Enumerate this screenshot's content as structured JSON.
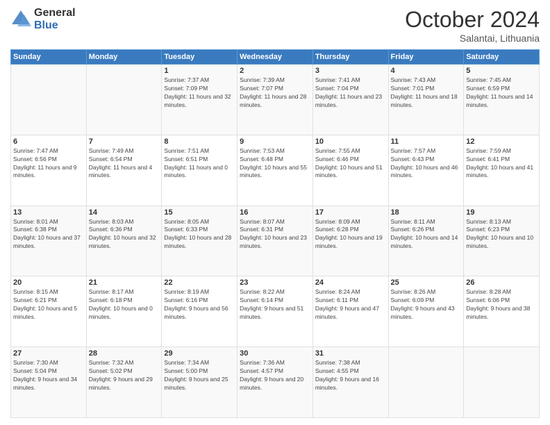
{
  "logo": {
    "general": "General",
    "blue": "Blue"
  },
  "header": {
    "month": "October 2024",
    "location": "Salantai, Lithuania"
  },
  "weekdays": [
    "Sunday",
    "Monday",
    "Tuesday",
    "Wednesday",
    "Thursday",
    "Friday",
    "Saturday"
  ],
  "weeks": [
    [
      {
        "day": "",
        "sunrise": "",
        "sunset": "",
        "daylight": ""
      },
      {
        "day": "",
        "sunrise": "",
        "sunset": "",
        "daylight": ""
      },
      {
        "day": "1",
        "sunrise": "Sunrise: 7:37 AM",
        "sunset": "Sunset: 7:09 PM",
        "daylight": "Daylight: 11 hours and 32 minutes."
      },
      {
        "day": "2",
        "sunrise": "Sunrise: 7:39 AM",
        "sunset": "Sunset: 7:07 PM",
        "daylight": "Daylight: 11 hours and 28 minutes."
      },
      {
        "day": "3",
        "sunrise": "Sunrise: 7:41 AM",
        "sunset": "Sunset: 7:04 PM",
        "daylight": "Daylight: 11 hours and 23 minutes."
      },
      {
        "day": "4",
        "sunrise": "Sunrise: 7:43 AM",
        "sunset": "Sunset: 7:01 PM",
        "daylight": "Daylight: 11 hours and 18 minutes."
      },
      {
        "day": "5",
        "sunrise": "Sunrise: 7:45 AM",
        "sunset": "Sunset: 6:59 PM",
        "daylight": "Daylight: 11 hours and 14 minutes."
      }
    ],
    [
      {
        "day": "6",
        "sunrise": "Sunrise: 7:47 AM",
        "sunset": "Sunset: 6:56 PM",
        "daylight": "Daylight: 11 hours and 9 minutes."
      },
      {
        "day": "7",
        "sunrise": "Sunrise: 7:49 AM",
        "sunset": "Sunset: 6:54 PM",
        "daylight": "Daylight: 11 hours and 4 minutes."
      },
      {
        "day": "8",
        "sunrise": "Sunrise: 7:51 AM",
        "sunset": "Sunset: 6:51 PM",
        "daylight": "Daylight: 11 hours and 0 minutes."
      },
      {
        "day": "9",
        "sunrise": "Sunrise: 7:53 AM",
        "sunset": "Sunset: 6:48 PM",
        "daylight": "Daylight: 10 hours and 55 minutes."
      },
      {
        "day": "10",
        "sunrise": "Sunrise: 7:55 AM",
        "sunset": "Sunset: 6:46 PM",
        "daylight": "Daylight: 10 hours and 51 minutes."
      },
      {
        "day": "11",
        "sunrise": "Sunrise: 7:57 AM",
        "sunset": "Sunset: 6:43 PM",
        "daylight": "Daylight: 10 hours and 46 minutes."
      },
      {
        "day": "12",
        "sunrise": "Sunrise: 7:59 AM",
        "sunset": "Sunset: 6:41 PM",
        "daylight": "Daylight: 10 hours and 41 minutes."
      }
    ],
    [
      {
        "day": "13",
        "sunrise": "Sunrise: 8:01 AM",
        "sunset": "Sunset: 6:38 PM",
        "daylight": "Daylight: 10 hours and 37 minutes."
      },
      {
        "day": "14",
        "sunrise": "Sunrise: 8:03 AM",
        "sunset": "Sunset: 6:36 PM",
        "daylight": "Daylight: 10 hours and 32 minutes."
      },
      {
        "day": "15",
        "sunrise": "Sunrise: 8:05 AM",
        "sunset": "Sunset: 6:33 PM",
        "daylight": "Daylight: 10 hours and 28 minutes."
      },
      {
        "day": "16",
        "sunrise": "Sunrise: 8:07 AM",
        "sunset": "Sunset: 6:31 PM",
        "daylight": "Daylight: 10 hours and 23 minutes."
      },
      {
        "day": "17",
        "sunrise": "Sunrise: 8:09 AM",
        "sunset": "Sunset: 6:28 PM",
        "daylight": "Daylight: 10 hours and 19 minutes."
      },
      {
        "day": "18",
        "sunrise": "Sunrise: 8:11 AM",
        "sunset": "Sunset: 6:26 PM",
        "daylight": "Daylight: 10 hours and 14 minutes."
      },
      {
        "day": "19",
        "sunrise": "Sunrise: 8:13 AM",
        "sunset": "Sunset: 6:23 PM",
        "daylight": "Daylight: 10 hours and 10 minutes."
      }
    ],
    [
      {
        "day": "20",
        "sunrise": "Sunrise: 8:15 AM",
        "sunset": "Sunset: 6:21 PM",
        "daylight": "Daylight: 10 hours and 5 minutes."
      },
      {
        "day": "21",
        "sunrise": "Sunrise: 8:17 AM",
        "sunset": "Sunset: 6:18 PM",
        "daylight": "Daylight: 10 hours and 0 minutes."
      },
      {
        "day": "22",
        "sunrise": "Sunrise: 8:19 AM",
        "sunset": "Sunset: 6:16 PM",
        "daylight": "Daylight: 9 hours and 56 minutes."
      },
      {
        "day": "23",
        "sunrise": "Sunrise: 8:22 AM",
        "sunset": "Sunset: 6:14 PM",
        "daylight": "Daylight: 9 hours and 51 minutes."
      },
      {
        "day": "24",
        "sunrise": "Sunrise: 8:24 AM",
        "sunset": "Sunset: 6:11 PM",
        "daylight": "Daylight: 9 hours and 47 minutes."
      },
      {
        "day": "25",
        "sunrise": "Sunrise: 8:26 AM",
        "sunset": "Sunset: 6:09 PM",
        "daylight": "Daylight: 9 hours and 43 minutes."
      },
      {
        "day": "26",
        "sunrise": "Sunrise: 8:28 AM",
        "sunset": "Sunset: 6:06 PM",
        "daylight": "Daylight: 9 hours and 38 minutes."
      }
    ],
    [
      {
        "day": "27",
        "sunrise": "Sunrise: 7:30 AM",
        "sunset": "Sunset: 5:04 PM",
        "daylight": "Daylight: 9 hours and 34 minutes."
      },
      {
        "day": "28",
        "sunrise": "Sunrise: 7:32 AM",
        "sunset": "Sunset: 5:02 PM",
        "daylight": "Daylight: 9 hours and 29 minutes."
      },
      {
        "day": "29",
        "sunrise": "Sunrise: 7:34 AM",
        "sunset": "Sunset: 5:00 PM",
        "daylight": "Daylight: 9 hours and 25 minutes."
      },
      {
        "day": "30",
        "sunrise": "Sunrise: 7:36 AM",
        "sunset": "Sunset: 4:57 PM",
        "daylight": "Daylight: 9 hours and 20 minutes."
      },
      {
        "day": "31",
        "sunrise": "Sunrise: 7:38 AM",
        "sunset": "Sunset: 4:55 PM",
        "daylight": "Daylight: 9 hours and 16 minutes."
      },
      {
        "day": "",
        "sunrise": "",
        "sunset": "",
        "daylight": ""
      },
      {
        "day": "",
        "sunrise": "",
        "sunset": "",
        "daylight": ""
      }
    ]
  ]
}
